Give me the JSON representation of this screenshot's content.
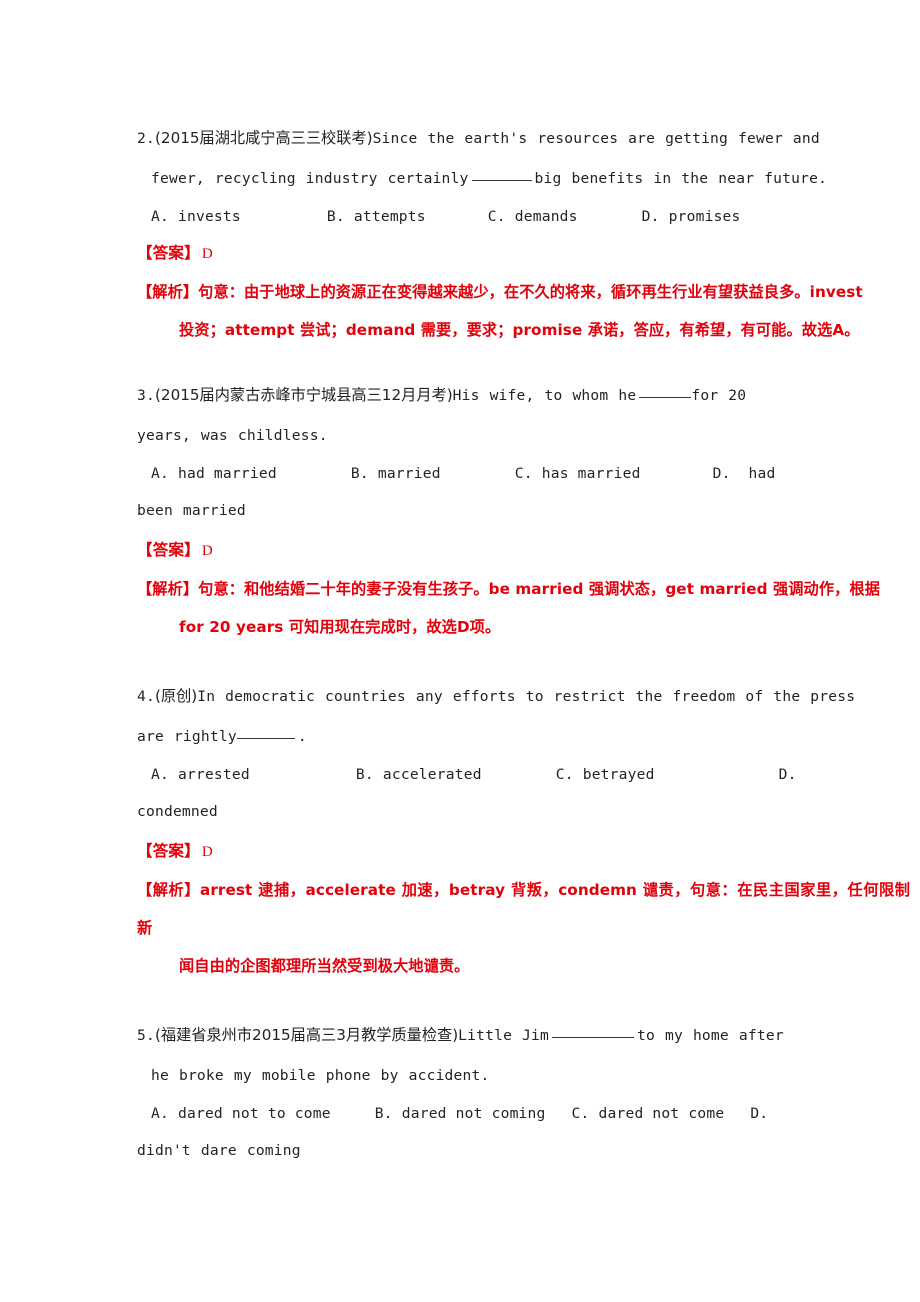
{
  "document": {
    "type": "exam-worksheet",
    "language": "zh-CN / en",
    "accent_color": "#e3000b",
    "body_color": "#262224",
    "background": "#ffffff"
  },
  "questions": [
    {
      "number": "2.",
      "source": "(2015届湖北咸宁高三三校联考)",
      "stem_line1": "Since the earth's resources are getting fewer and",
      "stem_line2_pre": "fewer, recycling industry certainly",
      "stem_line2_post": "big benefits in the near future.",
      "options": [
        {
          "label": "A.",
          "text": "invests"
        },
        {
          "label": "B.",
          "text": "attempts"
        },
        {
          "label": "C.",
          "text": "demands"
        },
        {
          "label": "D.",
          "text": "promises"
        }
      ],
      "answer_tag": "【答案】",
      "answer_value": "D",
      "analysis_tag": "【解析】",
      "analysis_line1": "句意：由于地球上的资源正在变得越来越少，在不久的将来，循环再生行业有望获益良多。invest",
      "analysis_line2": "投资；attempt 尝试；demand 需要，要求；promise 承诺，答应，有希望，有可能。故选A。"
    },
    {
      "number": "3.",
      "source": "(2015届内蒙古赤峰市宁城县高三12月月考)",
      "stem_line1": "His wife, to whom he",
      "stem_line1_post": "for 20",
      "stem_line2": "years, was childless.",
      "options": [
        {
          "label": "A.",
          "text": "had married"
        },
        {
          "label": "B.",
          "text": "married"
        },
        {
          "label": "C.",
          "text": "has married"
        },
        {
          "label": "D.",
          "text": "had"
        }
      ],
      "options_overflow": "been married",
      "answer_tag": "【答案】",
      "answer_value": "D",
      "analysis_tag": "【解析】",
      "analysis_line1": "句意：和他结婚二十年的妻子没有生孩子。be married 强调状态，get married 强调动作，根据",
      "analysis_line2": "for 20 years 可知用现在完成时，故选D项。"
    },
    {
      "number": "4.",
      "source": "(原创)",
      "stem_line1": "In democratic countries any efforts to restrict the freedom of the press",
      "stem_line2_pre": "are rightly",
      "stem_line2_post": ".",
      "options": [
        {
          "label": "A.",
          "text": "arrested"
        },
        {
          "label": "B.",
          "text": "accelerated"
        },
        {
          "label": "C.",
          "text": "betrayed"
        },
        {
          "label": "D.",
          "text": ""
        }
      ],
      "options_overflow": "condemned",
      "answer_tag": "【答案】",
      "answer_value": "D",
      "analysis_tag": "【解析】",
      "analysis_line1": "arrest 逮捕，accelerate 加速，betray 背叛，condemn 谴责，句意：在民主国家里，任何限制新",
      "analysis_line2": "闻自由的企图都理所当然受到极大地谴责。"
    },
    {
      "number": "5.",
      "source": "(福建省泉州市2015届高三3月教学质量检查)",
      "stem_line1_pre": "Little Jim",
      "stem_line1_post": "to my home after",
      "stem_line2": "he broke my mobile phone by accident.",
      "options": [
        {
          "label": "A.",
          "text": "dared not to come"
        },
        {
          "label": "B.",
          "text": "dared not coming"
        },
        {
          "label": "C.",
          "text": "dared not come"
        },
        {
          "label": "D.",
          "text": ""
        }
      ],
      "options_overflow": "didn't dare coming"
    }
  ]
}
